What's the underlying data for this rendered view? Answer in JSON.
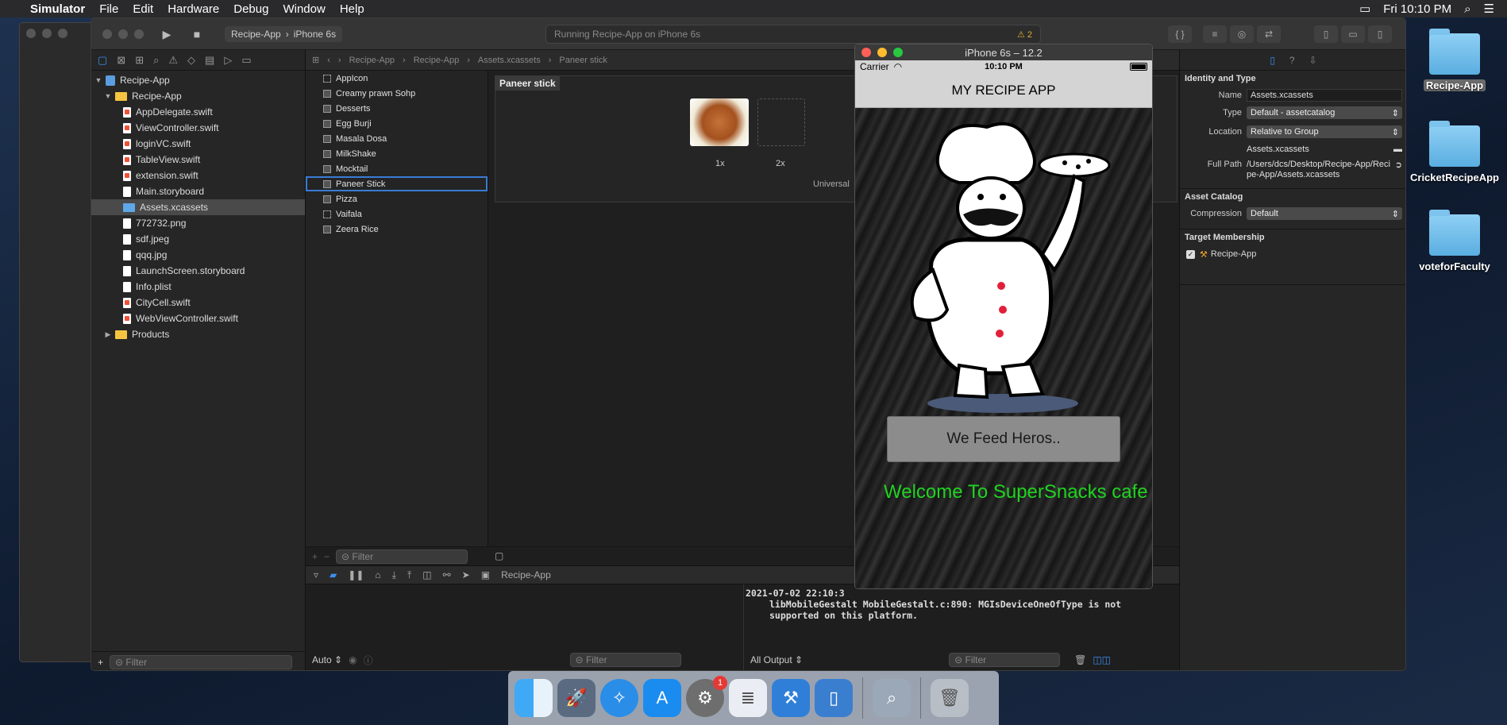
{
  "menubar": {
    "app_name": "Simulator",
    "items": [
      "File",
      "Edit",
      "Hardware",
      "Debug",
      "Window",
      "Help"
    ],
    "clock": "Fri 10:10 PM"
  },
  "toolbar": {
    "scheme": "Recipe-App",
    "device": "iPhone 6s",
    "status": "Running Recipe-App on iPhone 6s",
    "warning_count": "2"
  },
  "navigator": {
    "items": [
      {
        "label": "Recipe-App",
        "kind": "project"
      },
      {
        "label": "Recipe-App",
        "kind": "group"
      },
      {
        "label": "AppDelegate.swift",
        "kind": "swift"
      },
      {
        "label": "ViewController.swift",
        "kind": "swift"
      },
      {
        "label": "loginVC.swift",
        "kind": "swift"
      },
      {
        "label": "TableView.swift",
        "kind": "swift"
      },
      {
        "label": "extension.swift",
        "kind": "swift"
      },
      {
        "label": "Main.storyboard",
        "kind": "file"
      },
      {
        "label": "Assets.xcassets",
        "kind": "assets"
      },
      {
        "label": "772732.png",
        "kind": "file"
      },
      {
        "label": "sdf.jpeg",
        "kind": "file"
      },
      {
        "label": "qqq.jpg",
        "kind": "file"
      },
      {
        "label": "LaunchScreen.storyboard",
        "kind": "file"
      },
      {
        "label": "Info.plist",
        "kind": "file"
      },
      {
        "label": "CityCell.swift",
        "kind": "swift"
      },
      {
        "label": "WebViewController.swift",
        "kind": "swift"
      },
      {
        "label": "Products",
        "kind": "group"
      }
    ],
    "filter_placeholder": "Filter"
  },
  "jumpbar": {
    "crumbs": [
      "Recipe-App",
      "Recipe-App",
      "Assets.xcassets",
      "Paneer stick"
    ]
  },
  "assets": {
    "items": [
      "AppIcon",
      "Creamy prawn Sohp",
      "Desserts",
      "Egg Burji",
      "Masala Dosa",
      "MilkShake",
      "Mocktail",
      "Paneer Stick",
      "Pizza",
      "Vaifala",
      "Zeera Rice"
    ],
    "selected": "Paneer Stick",
    "filter_placeholder": "Filter"
  },
  "imageset": {
    "title": "Paneer stick",
    "slot_1x": "1x",
    "slot_2x": "2x",
    "universal": "Universal"
  },
  "debug": {
    "target": "Recipe-App",
    "console_line1": "2021-07-02 22:10:3",
    "console_line2": "libMobileGestalt MobileGestalt.c:890: MGIsDeviceOneOfType is not",
    "console_line3": "supported on this platform.",
    "auto_label": "Auto",
    "output_label": "All Output",
    "filter_placeholder": "Filter"
  },
  "inspector": {
    "identity_title": "Identity and Type",
    "name_label": "Name",
    "name_value": "Assets.xcassets",
    "type_label": "Type",
    "type_value": "Default - assetcatalog",
    "location_label": "Location",
    "location_value": "Relative to Group",
    "location_file": "Assets.xcassets",
    "fullpath_label": "Full Path",
    "fullpath_value": "/Users/dcs/Desktop/Recipe-App/Recipe-App/Assets.xcassets",
    "catalog_title": "Asset Catalog",
    "compression_label": "Compression",
    "compression_value": "Default",
    "membership_title": "Target Membership",
    "membership_target": "Recipe-App"
  },
  "simulator": {
    "title": "iPhone 6s – 12.2",
    "carrier": "Carrier",
    "time": "10:10 PM",
    "nav_title": "MY RECIPE APP",
    "button_label": "We Feed Heros..",
    "welcome_text": "Welcome To SuperSnacks cafe"
  },
  "desktop": {
    "folders": [
      "Recipe-App",
      "CricketRecipeApp",
      "voteforFaculty"
    ]
  },
  "dock": {
    "notification_badge": "1"
  }
}
